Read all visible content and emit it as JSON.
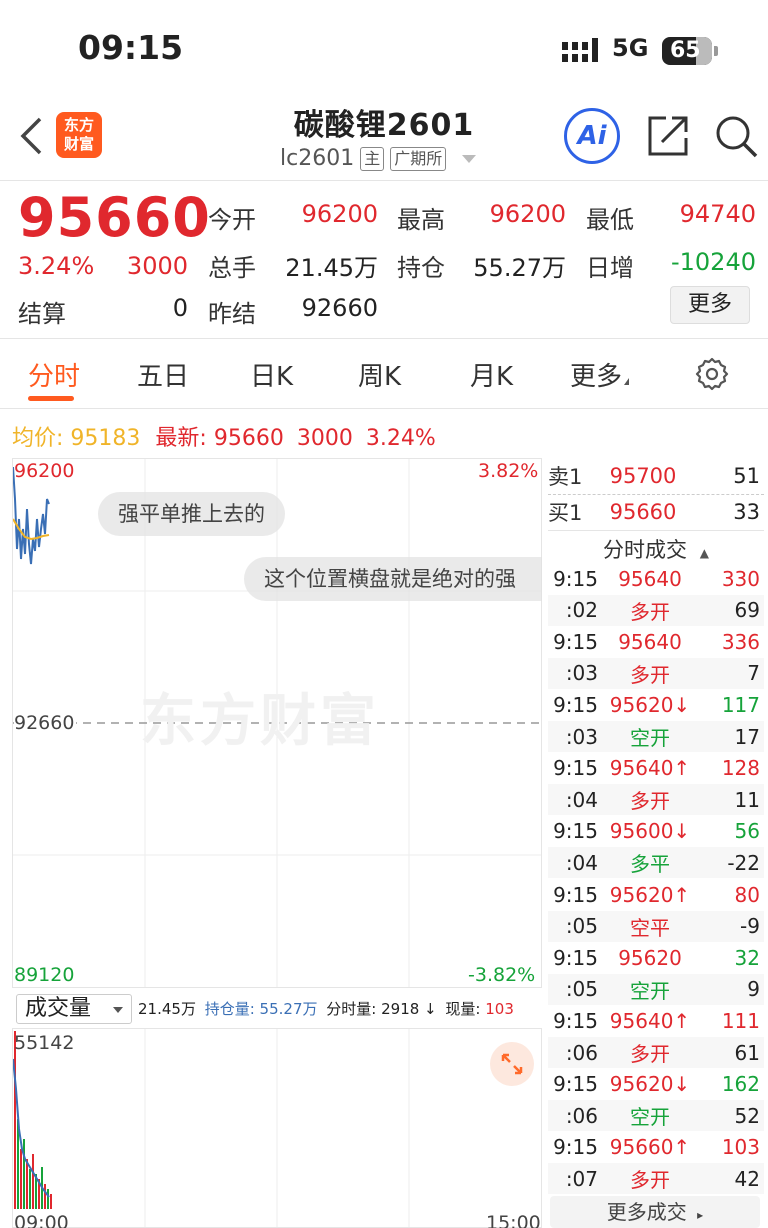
{
  "status": {
    "time": "09:15",
    "network": "5G",
    "battery": "65"
  },
  "header": {
    "logo_line1": "东方",
    "logo_line2": "财富",
    "title": "碳酸锂2601",
    "code": "lc2601",
    "tag_main": "主",
    "tag_exchange": "广期所",
    "ai_label": "Ai"
  },
  "quote": {
    "price": "95660",
    "change_pct": "3.24%",
    "change": "3000",
    "settle_label": "结算",
    "settle": "0",
    "open_label": "今开",
    "open": "96200",
    "high_label": "最高",
    "high": "96200",
    "low_label": "最低",
    "low": "94740",
    "volume_label": "总手",
    "volume": "21.45万",
    "oi_label": "持仓",
    "oi": "55.27万",
    "daily_label": "日增",
    "daily": "-10240",
    "prev_settle_label": "昨结",
    "prev_settle": "92660",
    "more_label": "更多"
  },
  "tabs": [
    {
      "label": "分时",
      "active": true
    },
    {
      "label": "五日"
    },
    {
      "label": "日K"
    },
    {
      "label": "周K"
    },
    {
      "label": "月K"
    },
    {
      "label": "更多"
    }
  ],
  "info": {
    "avg_label": "均价:",
    "avg": "95183",
    "latest_label": "最新:",
    "latest": "95660",
    "latest_change": "3000",
    "latest_pct": "3.24%"
  },
  "chart": {
    "max_label": "96200",
    "max_pct": "3.82%",
    "mid_label": "92660",
    "min_label": "89120",
    "min_pct": "-3.82%",
    "watermark": "东方财富",
    "bubble1": "强平单推上去的",
    "bubble2": "这个位置横盘就是绝对的强"
  },
  "volume": {
    "select_label": "成交量",
    "total": "21.45万",
    "oi_text": "持仓量: 55.27万",
    "tick_text": "分时量: 2918 ↓",
    "now_label": "现量:",
    "now": "103",
    "max_label": "55142",
    "time_start": "09:00",
    "time_end": "15:00"
  },
  "orderbook": [
    {
      "label": "卖1",
      "price": "95700",
      "vol": "51"
    },
    {
      "label": "买1",
      "price": "95660",
      "vol": "33"
    }
  ],
  "trades_title": "分时成交",
  "trades": [
    {
      "time": "9:15",
      "price": "95640",
      "pc": "red",
      "vol": "330",
      "vc": "red"
    },
    {
      "time": ":02",
      "price": "多开",
      "pc": "red",
      "vol": "69",
      "vc": "dark"
    },
    {
      "time": "9:15",
      "price": "95640",
      "pc": "red",
      "vol": "336",
      "vc": "red"
    },
    {
      "time": ":03",
      "price": "多开",
      "pc": "red",
      "vol": "7",
      "vc": "dark"
    },
    {
      "time": "9:15",
      "price": "95620↓",
      "pc": "red",
      "vol": "117",
      "vc": "green"
    },
    {
      "time": ":03",
      "price": "空开",
      "pc": "green",
      "vol": "17",
      "vc": "dark"
    },
    {
      "time": "9:15",
      "price": "95640↑",
      "pc": "red",
      "vol": "128",
      "vc": "red"
    },
    {
      "time": ":04",
      "price": "多开",
      "pc": "red",
      "vol": "11",
      "vc": "dark"
    },
    {
      "time": "9:15",
      "price": "95600↓",
      "pc": "red",
      "vol": "56",
      "vc": "green"
    },
    {
      "time": ":04",
      "price": "多平",
      "pc": "green",
      "vol": "-22",
      "vc": "dark"
    },
    {
      "time": "9:15",
      "price": "95620↑",
      "pc": "red",
      "vol": "80",
      "vc": "red"
    },
    {
      "time": ":05",
      "price": "空平",
      "pc": "red",
      "vol": "-9",
      "vc": "dark"
    },
    {
      "time": "9:15",
      "price": "95620",
      "pc": "red",
      "vol": "32",
      "vc": "green"
    },
    {
      "time": ":05",
      "price": "空开",
      "pc": "green",
      "vol": "9",
      "vc": "dark"
    },
    {
      "time": "9:15",
      "price": "95640↑",
      "pc": "red",
      "vol": "111",
      "vc": "red"
    },
    {
      "time": ":06",
      "price": "多开",
      "pc": "red",
      "vol": "61",
      "vc": "dark"
    },
    {
      "time": "9:15",
      "price": "95620↓",
      "pc": "red",
      "vol": "162",
      "vc": "green"
    },
    {
      "time": ":06",
      "price": "空开",
      "pc": "green",
      "vol": "52",
      "vc": "dark"
    },
    {
      "time": "9:15",
      "price": "95660↑",
      "pc": "red",
      "vol": "103",
      "vc": "red"
    },
    {
      "time": ":07",
      "price": "多开",
      "pc": "red",
      "vol": "42",
      "vc": "dark"
    }
  ],
  "more_trades_label": "更多成交",
  "colors": {
    "up": "#e0282e",
    "down": "#16a33a",
    "accent": "#ff5a1f",
    "avg": "#f0b429",
    "price_line": "#3a6fb5"
  }
}
